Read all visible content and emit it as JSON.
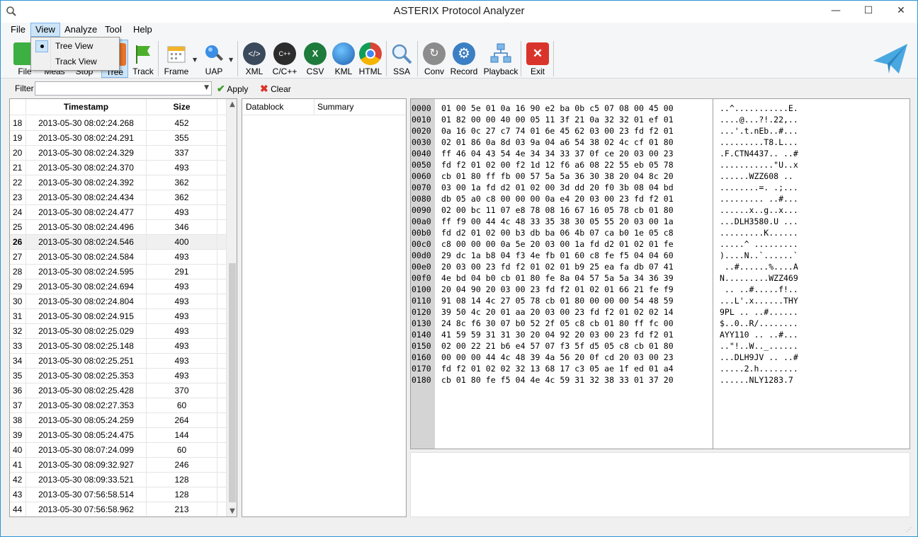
{
  "window": {
    "title": "ASTERIX Protocol Analyzer",
    "minimize": "—",
    "maximize": "☐",
    "close": "✕"
  },
  "menu": {
    "items": [
      "File",
      "View",
      "Analyze",
      "Tool",
      "Help"
    ],
    "view_dropdown": [
      "Tree View",
      "Track View"
    ]
  },
  "toolbar": {
    "tools": [
      {
        "label": "File",
        "icon": "plus-icon"
      },
      {
        "label": "Meas",
        "icon": "measure-icon"
      },
      {
        "label": "Stop",
        "icon": "stop-icon"
      },
      {
        "label": "Tree",
        "icon": "tree-icon"
      },
      {
        "label": "Track",
        "icon": "flag-icon"
      },
      {
        "label": "Frame",
        "icon": "calendar-icon"
      },
      {
        "label": "UAP",
        "icon": "magnifier-icon"
      },
      {
        "label": "XML",
        "icon": "xml-icon"
      },
      {
        "label": "C/C++",
        "icon": "cpp-icon"
      },
      {
        "label": "CSV",
        "icon": "excel-icon"
      },
      {
        "label": "KML",
        "icon": "globe-icon"
      },
      {
        "label": "HTML",
        "icon": "chrome-icon"
      },
      {
        "label": "SSA",
        "icon": "search-icon"
      },
      {
        "label": "Conv",
        "icon": "convert-icon"
      },
      {
        "label": "Record",
        "icon": "gear-icon"
      },
      {
        "label": "Playback",
        "icon": "network-icon"
      },
      {
        "label": "Exit",
        "icon": "exit-icon"
      }
    ]
  },
  "filter": {
    "label": "Filter",
    "value": "",
    "apply": "Apply",
    "clear": "Clear"
  },
  "packet_list": {
    "headers": {
      "timestamp": "Timestamp",
      "size": "Size"
    },
    "current": "26",
    "rows": [
      {
        "no": "18",
        "ts": "2013-05-30 08:02:24.268",
        "size": "452"
      },
      {
        "no": "19",
        "ts": "2013-05-30 08:02:24.291",
        "size": "355"
      },
      {
        "no": "20",
        "ts": "2013-05-30 08:02:24.329",
        "size": "337"
      },
      {
        "no": "21",
        "ts": "2013-05-30 08:02:24.370",
        "size": "493"
      },
      {
        "no": "22",
        "ts": "2013-05-30 08:02:24.392",
        "size": "362"
      },
      {
        "no": "23",
        "ts": "2013-05-30 08:02:24.434",
        "size": "362"
      },
      {
        "no": "24",
        "ts": "2013-05-30 08:02:24.477",
        "size": "493"
      },
      {
        "no": "25",
        "ts": "2013-05-30 08:02:24.496",
        "size": "346"
      },
      {
        "no": "26",
        "ts": "2013-05-30 08:02:24.546",
        "size": "400"
      },
      {
        "no": "27",
        "ts": "2013-05-30 08:02:24.584",
        "size": "493"
      },
      {
        "no": "28",
        "ts": "2013-05-30 08:02:24.595",
        "size": "291"
      },
      {
        "no": "29",
        "ts": "2013-05-30 08:02:24.694",
        "size": "493"
      },
      {
        "no": "30",
        "ts": "2013-05-30 08:02:24.804",
        "size": "493"
      },
      {
        "no": "31",
        "ts": "2013-05-30 08:02:24.915",
        "size": "493"
      },
      {
        "no": "32",
        "ts": "2013-05-30 08:02:25.029",
        "size": "493"
      },
      {
        "no": "33",
        "ts": "2013-05-30 08:02:25.148",
        "size": "493"
      },
      {
        "no": "34",
        "ts": "2013-05-30 08:02:25.251",
        "size": "493"
      },
      {
        "no": "35",
        "ts": "2013-05-30 08:02:25.353",
        "size": "493"
      },
      {
        "no": "36",
        "ts": "2013-05-30 08:02:25.428",
        "size": "370"
      },
      {
        "no": "37",
        "ts": "2013-05-30 08:02:27.353",
        "size": "60"
      },
      {
        "no": "38",
        "ts": "2013-05-30 08:05:24.259",
        "size": "264"
      },
      {
        "no": "39",
        "ts": "2013-05-30 08:05:24.475",
        "size": "144"
      },
      {
        "no": "40",
        "ts": "2013-05-30 08:07:24.099",
        "size": "60"
      },
      {
        "no": "41",
        "ts": "2013-05-30 08:09:32.927",
        "size": "246"
      },
      {
        "no": "42",
        "ts": "2013-05-30 08:09:33.521",
        "size": "128"
      },
      {
        "no": "43",
        "ts": "2013-05-30 07:56:58.514",
        "size": "128"
      },
      {
        "no": "44",
        "ts": "2013-05-30 07:56:58.962",
        "size": "213"
      }
    ]
  },
  "datablock": {
    "headers": {
      "datablock": "Datablock",
      "summary": "Summary"
    }
  },
  "hexdump": {
    "lines": [
      {
        "off": "0000",
        "hex": "01 00 5e 01 0a 16 90 e2 ba 0b c5 07 08 00 45 00",
        "ascii": "..^...........E."
      },
      {
        "off": "0010",
        "hex": "01 82 00 00 40 00 05 11 3f 21 0a 32 32 01 ef 01",
        "ascii": "....@...?!.22,.."
      },
      {
        "off": "0020",
        "hex": "0a 16 0c 27 c7 74 01 6e 45 62 03 00 23 fd f2 01",
        "ascii": "...'.t.nEb..#..."
      },
      {
        "off": "0030",
        "hex": "02 01 86 0a 8d 03 9a 04 a6 54 38 02 4c cf 01 80",
        "ascii": ".........T8.L..."
      },
      {
        "off": "0040",
        "hex": "ff 46 04 43 54 4e 34 34 33 37 0f ce 20 03 00 23",
        "ascii": ".F.CTN4437.. ..#"
      },
      {
        "off": "0050",
        "hex": "fd f2 01 02 00 f2 1d 12 f6 a6 08 22 55 eb 05 78",
        "ascii": "...........\"U..x"
      },
      {
        "off": "0060",
        "hex": "cb 01 80 ff fb 00 57 5a 5a 36 30 38 20 04 8c 20",
        "ascii": "......WZZ608 .. "
      },
      {
        "off": "0070",
        "hex": "03 00 1a fd d2 01 02 00 3d dd 20 f0 3b 08 04 bd",
        "ascii": "........=. .;..."
      },
      {
        "off": "0080",
        "hex": "db 05 a0 c8 00 00 00 0a e4 20 03 00 23 fd f2 01",
        "ascii": "......... ..#..."
      },
      {
        "off": "0090",
        "hex": "02 00 bc 11 07 e8 78 08 16 67 16 05 78 cb 01 80",
        "ascii": "......x..g..x..."
      },
      {
        "off": "00a0",
        "hex": "ff f9 00 44 4c 48 33 35 38 30 05 55 20 03 00 1a",
        "ascii": "...DLH3580.U ..."
      },
      {
        "off": "00b0",
        "hex": "fd d2 01 02 00 b3 db ba 06 4b 07 ca b0 1e 05 c8",
        "ascii": ".........K......"
      },
      {
        "off": "00c0",
        "hex": "c8 00 00 00 0a 5e 20 03 00 1a fd d2 01 02 01 fe",
        "ascii": ".....^ ........."
      },
      {
        "off": "00d0",
        "hex": "29 dc 1a b8 04 f3 4e fb 01 60 c8 fe f5 04 04 60",
        "ascii": ")....N..`......`"
      },
      {
        "off": "00e0",
        "hex": "20 03 00 23 fd f2 01 02 01 b9 25 ea fa db 07 41",
        "ascii": " ..#......%....A"
      },
      {
        "off": "00f0",
        "hex": "4e bd 04 b0 cb 01 80 fe 8a 04 57 5a 5a 34 36 39",
        "ascii": "N.........WZZ469"
      },
      {
        "off": "0100",
        "hex": "20 04 90 20 03 00 23 fd f2 01 02 01 66 21 fe f9",
        "ascii": " .. ..#.....f!.."
      },
      {
        "off": "0110",
        "hex": "91 08 14 4c 27 05 78 cb 01 80 00 00 00 54 48 59",
        "ascii": "...L'.x......THY"
      },
      {
        "off": "0120",
        "hex": "39 50 4c 20 01 aa 20 03 00 23 fd f2 01 02 02 14",
        "ascii": "9PL .. ..#......"
      },
      {
        "off": "0130",
        "hex": "24 8c f6 30 07 b0 52 2f 05 c8 cb 01 80 ff fc 00",
        "ascii": "$..0..R/........"
      },
      {
        "off": "0140",
        "hex": "41 59 59 31 31 30 20 04 92 20 03 00 23 fd f2 01",
        "ascii": "AYY110 .. ..#..."
      },
      {
        "off": "0150",
        "hex": "02 00 22 21 b6 e4 57 07 f3 5f d5 05 c8 cb 01 80",
        "ascii": "..\"!..W.._......"
      },
      {
        "off": "0160",
        "hex": "00 00 00 44 4c 48 39 4a 56 20 0f cd 20 03 00 23",
        "ascii": "...DLH9JV .. ..#"
      },
      {
        "off": "0170",
        "hex": "fd f2 01 02 02 32 13 68 17 c3 05 ae 1f ed 01 a4",
        "ascii": ".....2.h........"
      },
      {
        "off": "0180",
        "hex": "cb 01 80 fe f5 04 4e 4c 59 31 32 38 33 01 37 20",
        "ascii": "......NLY1283.7 "
      }
    ]
  }
}
